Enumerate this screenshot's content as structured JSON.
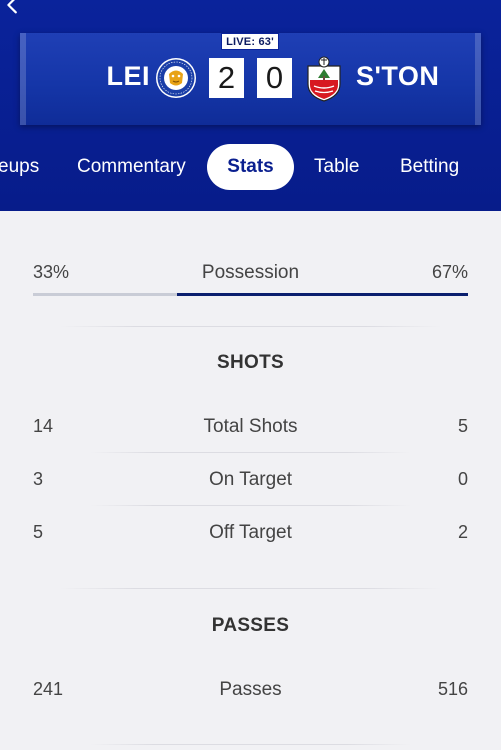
{
  "match": {
    "live_label": "LIVE: 63'",
    "home_team": "LEI",
    "away_team": "S'TON",
    "home_score": "2",
    "away_score": "0"
  },
  "tabs": [
    {
      "label": "Lineups",
      "active": false
    },
    {
      "label": "Commentary",
      "active": false
    },
    {
      "label": "Stats",
      "active": true
    },
    {
      "label": "Table",
      "active": false
    },
    {
      "label": "Betting",
      "active": false
    }
  ],
  "tabs_visible_first_label": "eups",
  "possession": {
    "home": "33%",
    "label": "Possession",
    "away": "67%",
    "home_fraction": 0.33,
    "away_fraction": 0.67
  },
  "sections": {
    "shots": {
      "title": "SHOTS",
      "rows": [
        {
          "home": "14",
          "label": "Total Shots",
          "away": "5"
        },
        {
          "home": "3",
          "label": "On Target",
          "away": "0"
        },
        {
          "home": "5",
          "label": "Off Target",
          "away": "2"
        }
      ]
    },
    "passes": {
      "title": "PASSES",
      "rows": [
        {
          "home": "241",
          "label": "Passes",
          "away": "516"
        }
      ]
    }
  },
  "colors": {
    "header_blue": "#0a239b",
    "active_tab_text": "#0a1f8f",
    "possession_away": "#0a1f6e",
    "possession_home": "#c9ccd6"
  },
  "icons": {
    "back": "chevron-left-icon",
    "home_crest": "leicester-city-crest-icon",
    "away_crest": "southampton-crest-icon"
  }
}
